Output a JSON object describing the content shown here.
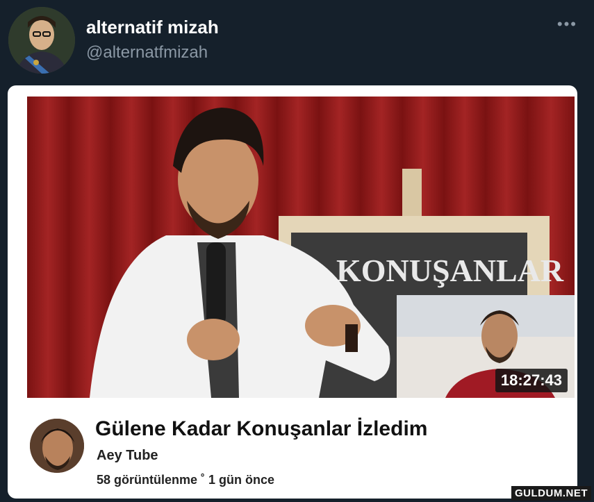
{
  "tweet": {
    "display_name": "alternatif mizah",
    "handle": "@alternatfmizah",
    "more_label": "•••"
  },
  "video": {
    "sign_text": "KONUŞANLAR",
    "duration": "18:27:43",
    "title": "Gülene Kadar Konuşanlar İzledim",
    "channel": "Aey Tube",
    "meta": "58 görüntülenme ˚ 1 gün önce"
  },
  "watermark": "GULDUM.NET",
  "colors": {
    "background": "#15202b",
    "curtain": "#8a1a1a",
    "text_secondary": "#8b98a5"
  }
}
